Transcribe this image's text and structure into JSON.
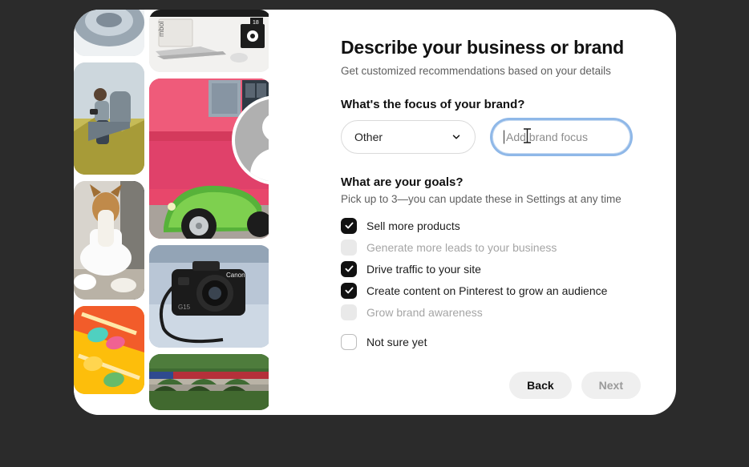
{
  "theme": {
    "page_background": "#2b2b2b",
    "card_background": "#ffffff",
    "focus_ring": "#8fb8e8",
    "checkbox_checked": "#111111",
    "checkbox_disabled": "#e9e9e9",
    "button_background": "#efefef"
  },
  "dialog": {
    "title": "Describe your business or brand",
    "subtitle": "Get customized recommendations based on your details"
  },
  "avatar": {
    "name": "profile-avatar",
    "edit_icon": "pencil-icon"
  },
  "collage": {
    "tiles": [
      {
        "name": "image-tile-appliance",
        "alt": "Close-up of a metal appliance"
      },
      {
        "name": "image-tile-laptop-desk",
        "alt": "Laptop and mouse on a white desk"
      },
      {
        "name": "image-tile-man-outdoors",
        "alt": "Man sitting outdoors looking at phone"
      },
      {
        "name": "image-tile-pink-house-car",
        "alt": "Green vintage car in front of pink house"
      },
      {
        "name": "image-tile-dog-toilet",
        "alt": "Dog sitting on a toilet"
      },
      {
        "name": "image-tile-camera",
        "alt": "Black compact camera on a desk"
      },
      {
        "name": "image-tile-slinky-toys",
        "alt": "Colorful slinky toys on orange background"
      },
      {
        "name": "image-tile-train-viaduct",
        "alt": "Train crossing a stone viaduct"
      }
    ]
  },
  "focus": {
    "question": "What's the focus of your brand?",
    "select_value": "Other",
    "select_icon": "chevron-down-icon",
    "input_value": "",
    "input_placeholder": "Add brand focus"
  },
  "goals": {
    "question": "What are your goals?",
    "help": "Pick up to 3—you can update these in Settings at any time",
    "items": [
      {
        "label": "Sell more products",
        "state": "checked"
      },
      {
        "label": "Generate more leads to your business",
        "state": "disabled"
      },
      {
        "label": "Drive traffic to your site",
        "state": "checked"
      },
      {
        "label": "Create content on Pinterest to grow an audience",
        "state": "checked"
      },
      {
        "label": "Grow brand awareness",
        "state": "disabled"
      },
      {
        "label": "Not sure yet",
        "state": "empty"
      }
    ]
  },
  "footer": {
    "back_label": "Back",
    "next_label": "Next"
  },
  "cursor": {
    "type": "text-ibeam-cursor"
  }
}
